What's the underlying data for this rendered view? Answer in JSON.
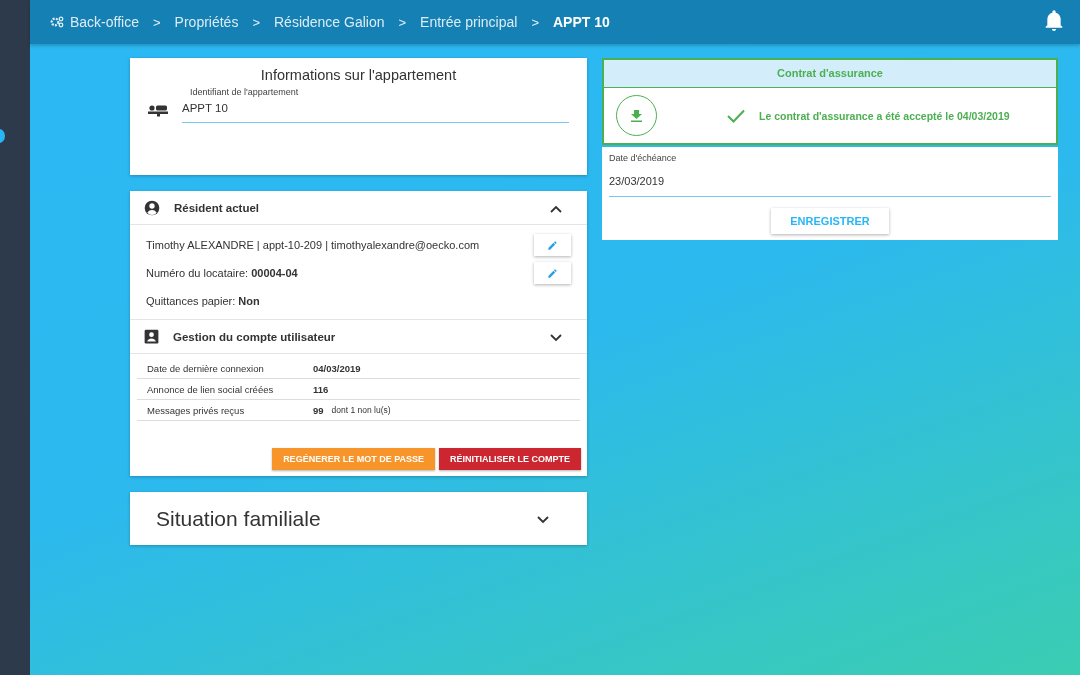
{
  "breadcrumb": [
    {
      "label": "Back-office",
      "current": false
    },
    {
      "label": "Propriétés",
      "current": false
    },
    {
      "label": "Résidence Galion",
      "current": false
    },
    {
      "label": "Entrée principal",
      "current": false
    },
    {
      "label": "APPT 10",
      "current": true
    }
  ],
  "separator": ">",
  "apartment": {
    "title": "Informations sur l'appartement",
    "field_label": "Identifiant de l'appartement",
    "value": "APPT 10"
  },
  "resident": {
    "title": "Résident actuel",
    "expanded": true,
    "lines": [
      {
        "text": "Timothy ALEXANDRE | appt-10-209 | timothyalexandre@oecko.com",
        "editable": true
      },
      {
        "text": "Numéro du locataire: **00004-04**",
        "editable": true
      },
      {
        "text": "Quittances papier: **Non**",
        "editable": false
      }
    ]
  },
  "account": {
    "title": "Gestion du compte utilisateur",
    "expanded": false,
    "rows": [
      {
        "label": "Date de dernière connexion",
        "value": "04/03/2019"
      },
      {
        "label": "Annonce de lien social créées",
        "value": "116"
      },
      {
        "label": "Messages privés reçus",
        "value": "99",
        "note": "dont 1 non lu(s)"
      }
    ],
    "buttons": [
      {
        "label": "REGÉNERER LE MOT DE PASSE",
        "kind": "warning"
      },
      {
        "label": "RÉINITIALISER LE COMPTE",
        "kind": "danger"
      }
    ]
  },
  "family": {
    "title": "Situation familiale",
    "expanded": false
  },
  "insurance": {
    "title": "Contrat d'assurance",
    "status": "Le contrat d'assurance a été accepté le 04/03/2019",
    "accepted": true
  },
  "due_date": {
    "label": "Date d'échéance",
    "value": "23/03/2019",
    "button": "ENREGISTRER"
  }
}
